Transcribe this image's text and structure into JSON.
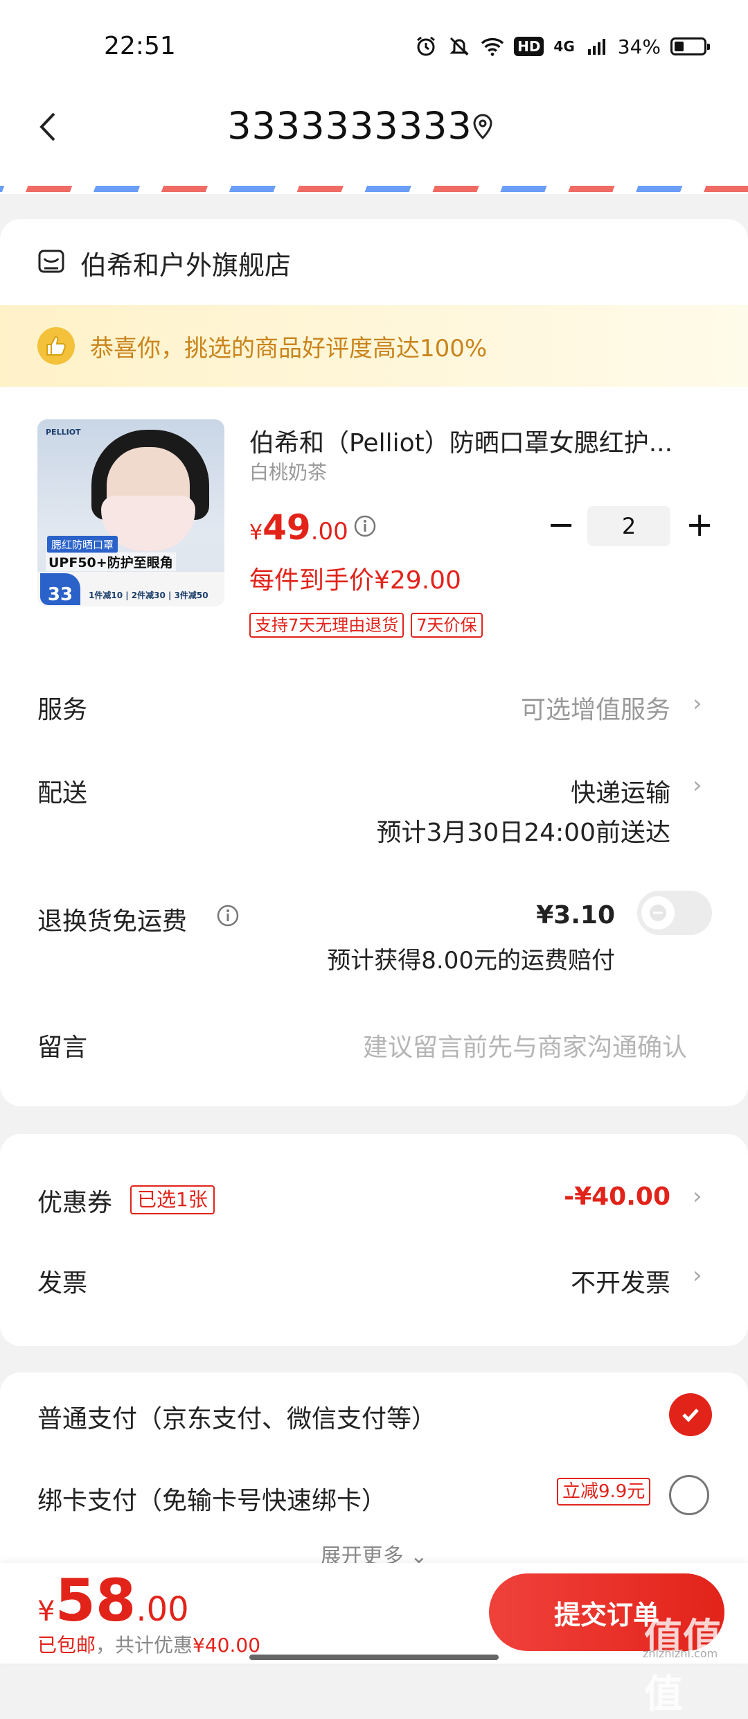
{
  "status": {
    "time": "22:51",
    "battery": "34%",
    "net": "4G",
    "hd": "HD"
  },
  "nav": {
    "title": "3333333333"
  },
  "store": {
    "name": "伯希和户外旗舰店"
  },
  "banner": {
    "text": "恭喜你，挑选的商品好评度高达100%"
  },
  "product": {
    "img_logo": "PELLIOT",
    "img_tag": "腮红防晒口罩",
    "img_upf": "UPF50+防护至眼角",
    "img_num": "33",
    "img_deal": "1件减10 | 2件减30 | 3件减50",
    "title": "伯希和（Pelliot）防晒口罩女腮红护...",
    "variant": "白桃奶茶",
    "price_symbol": "¥",
    "price_int": "49",
    "price_dec": ".00",
    "quantity": "2",
    "minus": "−",
    "plus": "+",
    "per_price": "每件到手价¥29.00",
    "badges": [
      "支持7天无理由退货",
      "7天价保"
    ]
  },
  "rows": {
    "service_label": "服务",
    "service_value": "可选增值服务",
    "delivery_label": "配送",
    "delivery_value": "快递运输",
    "delivery_eta": "预计3月30日24:00前送达",
    "return_label": "退换货免运费",
    "return_price": "¥3.10",
    "return_note": "预计获得8.00元的运费赔付",
    "message_label": "留言",
    "message_placeholder": "建议留言前先与商家沟通确认"
  },
  "coupon": {
    "label": "优惠券",
    "tag": "已选1张",
    "value": "-¥40.00"
  },
  "invoice": {
    "label": "发票",
    "value": "不开发票"
  },
  "payment": {
    "normal": "普通支付（京东支付、微信支付等）",
    "card": "绑卡支付（免输卡号快速绑卡）",
    "card_tag": "立减9.9元",
    "expand": "展开更多"
  },
  "footer": {
    "total_symbol": "¥",
    "total_int": "58",
    "total_dec": ".00",
    "ship_free": "已包邮",
    "discount_note": "，共计优惠",
    "discount_amount": "¥40.00",
    "submit": "提交订单",
    "watermark": "值值值",
    "watermark_sub": "zhizhizhi.com"
  },
  "colors": {
    "accent": "#e2231a",
    "banner_text": "#c9841b",
    "background": "#f2f2f2"
  }
}
